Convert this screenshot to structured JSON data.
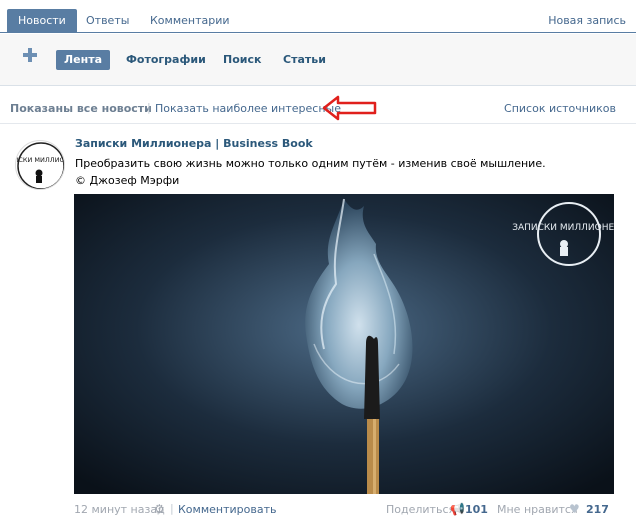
{
  "tabs": {
    "items": [
      {
        "label": "Новости",
        "active": true
      },
      {
        "label": "Ответы",
        "active": false
      },
      {
        "label": "Комментарии",
        "active": false
      }
    ],
    "new_post": "Новая запись"
  },
  "subnav": {
    "items": [
      {
        "label": "Лента",
        "active": true
      },
      {
        "label": "Фотографии",
        "active": false
      },
      {
        "label": "Поиск",
        "active": false
      },
      {
        "label": "Статьи",
        "active": false
      }
    ]
  },
  "filter": {
    "shown": "Показаны все новости",
    "separator": "|",
    "interesting": "Показать наиболее интересные",
    "sources": "Список источников"
  },
  "post": {
    "author": "Записки Миллионера | Business Book",
    "avatar_text": "ЗАПИСКИ МИЛЛИОНЕРА",
    "text_line1": "Преобразить свою жизнь можно только одним путём - изменив своё мышление.",
    "text_line2": "© Джозеф Мэрфи",
    "watermark": "ЗАПИСКИ МИЛЛИОНЕРА",
    "time": "12 минут назад",
    "separator": "|",
    "comment": "Комментировать",
    "share_label": "Поделиться",
    "share_count": "101",
    "like_label": "Мне нравится",
    "like_count": "217"
  },
  "colors": {
    "accent": "#597da3",
    "link": "#45688e",
    "arrow": "#e0201c"
  },
  "icons": {
    "plus": "plus-icon",
    "gear": "gear-icon",
    "share": "megaphone-icon",
    "like": "heart-icon",
    "arrow": "left-arrow-icon"
  }
}
